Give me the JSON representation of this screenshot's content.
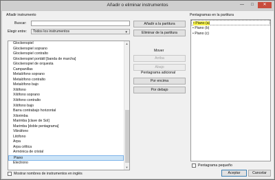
{
  "window": {
    "title": "Añadir o eliminar instrumentos"
  },
  "titlebar_buttons": {
    "minimize": "—",
    "maximize": "□",
    "close": "✕"
  },
  "add_panel": {
    "heading": "Añadir instrumento",
    "search_label": "Buscar:",
    "search_value": "",
    "choose_label": "Elegir entre:",
    "choose_value": "Todos los instrumentos",
    "instruments": [
      "Glockenspiel",
      "Glockenspiel soprano",
      "Glockenspiel contralto",
      "Glockenspiel portátil [banda de marcha]",
      "Glockenspiel de orquesta",
      "Campanillas",
      "Metalófono soprano",
      "Metalófono contralto",
      "Metalófono bajo",
      "Xilófono",
      "Xilófono soprano",
      "Xilófono contralto",
      "Xilófono bajo",
      "Barra contrabajo horizontal",
      "Xilorimba",
      "Marimba [clave de Sol]",
      "Marimba [doble pentagrama]",
      "Vibráfono",
      "Litófono",
      "Arpa",
      "Arpa céltica",
      "Armónica de cristal",
      "Piano",
      "Electrono"
    ],
    "selected_index": 22,
    "show_english_label": "Mostrar nombres de instrumentos en inglés"
  },
  "center": {
    "add_button": "Añadir a la partitura",
    "remove_button": "Eliminar de la partitura",
    "move_heading": "Mover",
    "up_button": "Arriba",
    "down_button": "Abajo",
    "extra_staff_heading": "Pentagrama adicional",
    "above_button": "Por encima",
    "below_button": "Por debajo"
  },
  "score_panel": {
    "heading": "Pentagramas en la partitura",
    "staves": [
      {
        "bullet": "•",
        "label": "Piano (a)",
        "highlighted": true
      },
      {
        "bullet": "•",
        "label": "Piano (b)",
        "highlighted": false
      },
      {
        "bullet": "•",
        "label": "Piano (c)",
        "highlighted": false
      }
    ],
    "small_staff_label": "Pentagrama pequeño"
  },
  "footer": {
    "accept_button": "Aceptar",
    "cancel_button": "Cancelar"
  },
  "icons": {
    "dropdown": "chevron-down-icon",
    "scroll_up": "arrow-up-icon",
    "scroll_down": "arrow-down-icon"
  },
  "colors": {
    "highlight": "#f7f34a",
    "selection": "#cce4f7",
    "close_button": "#c84c3c"
  }
}
